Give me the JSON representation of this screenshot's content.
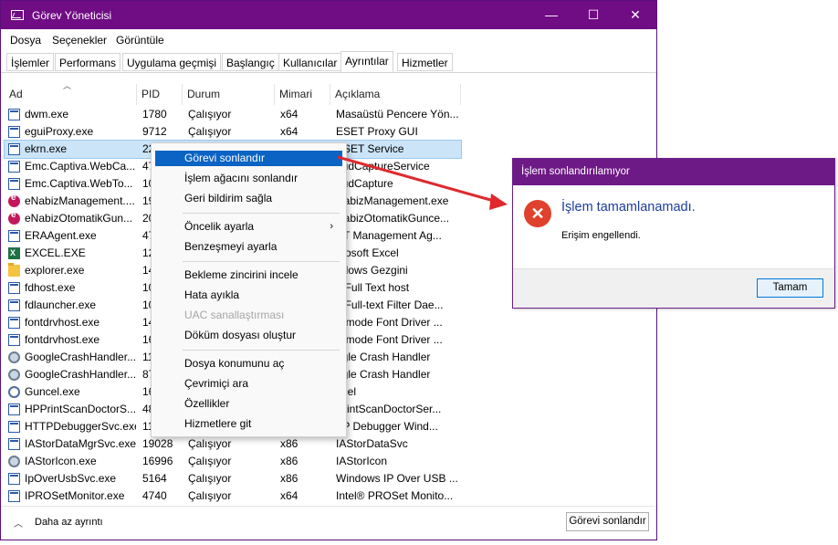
{
  "window": {
    "title": "Görev Yöneticisi",
    "controls": {
      "minimize": "—",
      "maximize": "☐",
      "close": "✕"
    }
  },
  "menu": [
    "Dosya",
    "Seçenekler",
    "Görüntüle"
  ],
  "tabs": [
    {
      "label": "İşlemler"
    },
    {
      "label": "Performans"
    },
    {
      "label": "Uygulama geçmişi"
    },
    {
      "label": "Başlangıç"
    },
    {
      "label": "Kullanıcılar"
    },
    {
      "label": "Ayrıntılar",
      "active": true
    },
    {
      "label": "Hizmetler"
    }
  ],
  "columns": [
    "Ad",
    "PID",
    "Durum",
    "Mimari",
    "Açıklama"
  ],
  "rows": [
    {
      "name": "dwm.exe",
      "pid": "1780",
      "status": "Çalışıyor",
      "arch": "x64",
      "desc": "Masaüstü Pencere Yön...",
      "icon": "app-icon"
    },
    {
      "name": "eguiProxy.exe",
      "pid": "9712",
      "status": "Çalışıyor",
      "arch": "x64",
      "desc": "ESET Proxy GUI",
      "icon": "app-icon"
    },
    {
      "name": "ekrn.exe",
      "pid": "2264",
      "status": "Ç",
      "arch": "x64",
      "desc": "ESET Service",
      "icon": "app-icon",
      "selected": true
    },
    {
      "name": "Emc.Captiva.WebCa...",
      "pid": "47",
      "status": "",
      "arch": "",
      "desc": "oudCaptureService",
      "icon": "app-icon"
    },
    {
      "name": "Emc.Captiva.WebTo...",
      "pid": "10",
      "status": "",
      "arch": "",
      "desc": "oudCapture",
      "icon": "app-icon"
    },
    {
      "name": "eNabizManagement....",
      "pid": "19",
      "status": "",
      "arch": "",
      "desc": "NabizManagement.exe",
      "icon": "enabiz-icon"
    },
    {
      "name": "eNabizOtomatikGun...",
      "pid": "20",
      "status": "",
      "arch": "",
      "desc": "NabizOtomatikGunce...",
      "icon": "enabiz-icon"
    },
    {
      "name": "ERAAgent.exe",
      "pid": "47",
      "status": "",
      "arch": "",
      "desc": "ET Management Ag...",
      "icon": "app-icon"
    },
    {
      "name": "EXCEL.EXE",
      "pid": "12",
      "status": "",
      "arch": "",
      "desc": "crosoft Excel",
      "icon": "excel-icon"
    },
    {
      "name": "explorer.exe",
      "pid": "14",
      "status": "",
      "arch": "",
      "desc": "ndows Gezgini",
      "icon": "folder-icon"
    },
    {
      "name": "fdhost.exe",
      "pid": "10",
      "status": "",
      "arch": "",
      "desc": "L Full Text host",
      "icon": "app-icon"
    },
    {
      "name": "fdlauncher.exe",
      "pid": "10",
      "status": "",
      "arch": "",
      "desc": "L Full-text Filter Dae...",
      "icon": "app-icon"
    },
    {
      "name": "fontdrvhost.exe",
      "pid": "14",
      "status": "",
      "arch": "",
      "desc": "ermode Font Driver ...",
      "icon": "app-icon"
    },
    {
      "name": "fontdrvhost.exe",
      "pid": "16",
      "status": "",
      "arch": "",
      "desc": "ermode Font Driver ...",
      "icon": "app-icon"
    },
    {
      "name": "GoogleCrashHandler....",
      "pid": "11",
      "status": "",
      "arch": "",
      "desc": "ogle Crash Handler",
      "icon": "gear-icon"
    },
    {
      "name": "GoogleCrashHandler....",
      "pid": "87",
      "status": "",
      "arch": "",
      "desc": "ogle Crash Handler",
      "icon": "gear-icon"
    },
    {
      "name": "Guncel.exe",
      "pid": "16",
      "status": "",
      "arch": "",
      "desc": "ncel",
      "icon": "g-icon"
    },
    {
      "name": "HPPrintScanDoctorS...",
      "pid": "48",
      "status": "",
      "arch": "",
      "desc": "PrintScanDoctorSer...",
      "icon": "app-icon"
    },
    {
      "name": "HTTPDebuggerSvc.exe",
      "pid": "11",
      "status": "",
      "arch": "",
      "desc": "TP Debugger Wind...",
      "icon": "app-icon"
    },
    {
      "name": "IAStorDataMgrSvc.exe",
      "pid": "19028",
      "status": "Çalışıyor",
      "arch": "x86",
      "desc": "IAStorDataSvc",
      "icon": "app-icon"
    },
    {
      "name": "IAStorIcon.exe",
      "pid": "16996",
      "status": "Çalışıyor",
      "arch": "x86",
      "desc": "IAStorIcon",
      "icon": "gear-icon"
    },
    {
      "name": "IpOverUsbSvc.exe",
      "pid": "5164",
      "status": "Çalışıyor",
      "arch": "x86",
      "desc": "Windows IP Over USB ...",
      "icon": "app-icon"
    },
    {
      "name": "IPROSetMonitor.exe",
      "pid": "4740",
      "status": "Çalışıyor",
      "arch": "x64",
      "desc": "Intel® PROSet Monito...",
      "icon": "app-icon"
    }
  ],
  "context_menu": [
    {
      "type": "item",
      "label": "Görevi sonlandır",
      "highlighted": true
    },
    {
      "type": "item",
      "label": "İşlem ağacını sonlandır"
    },
    {
      "type": "item",
      "label": "Geri bildirim sağla"
    },
    {
      "type": "sep"
    },
    {
      "type": "item",
      "label": "Öncelik ayarla",
      "submenu": true
    },
    {
      "type": "item",
      "label": "Benzeşmeyi ayarla"
    },
    {
      "type": "sep"
    },
    {
      "type": "item",
      "label": "Bekleme zincirini incele"
    },
    {
      "type": "item",
      "label": "Hata ayıkla"
    },
    {
      "type": "item",
      "label": "UAC sanallaştırması",
      "disabled": true
    },
    {
      "type": "item",
      "label": "Döküm dosyası oluştur"
    },
    {
      "type": "sep"
    },
    {
      "type": "item",
      "label": "Dosya konumunu aç"
    },
    {
      "type": "item",
      "label": "Çevrimiçi ara"
    },
    {
      "type": "item",
      "label": "Özellikler"
    },
    {
      "type": "item",
      "label": "Hizmetlere git"
    }
  ],
  "footer": {
    "less_details": "Daha az ayrıntı",
    "end_task": "Görevi sonlandır"
  },
  "dialog": {
    "title": "İşlem sonlandırılamıyor",
    "main": "İşlem tamamlanamadı.",
    "sub": "Erişim engellendi.",
    "ok": "Tamam"
  },
  "colors": {
    "titlebar": "#700c84",
    "selection": "#cce4f7",
    "menu_highlight": "#0b63c4",
    "arrow": "#e0282d",
    "error": "#e0412c"
  }
}
